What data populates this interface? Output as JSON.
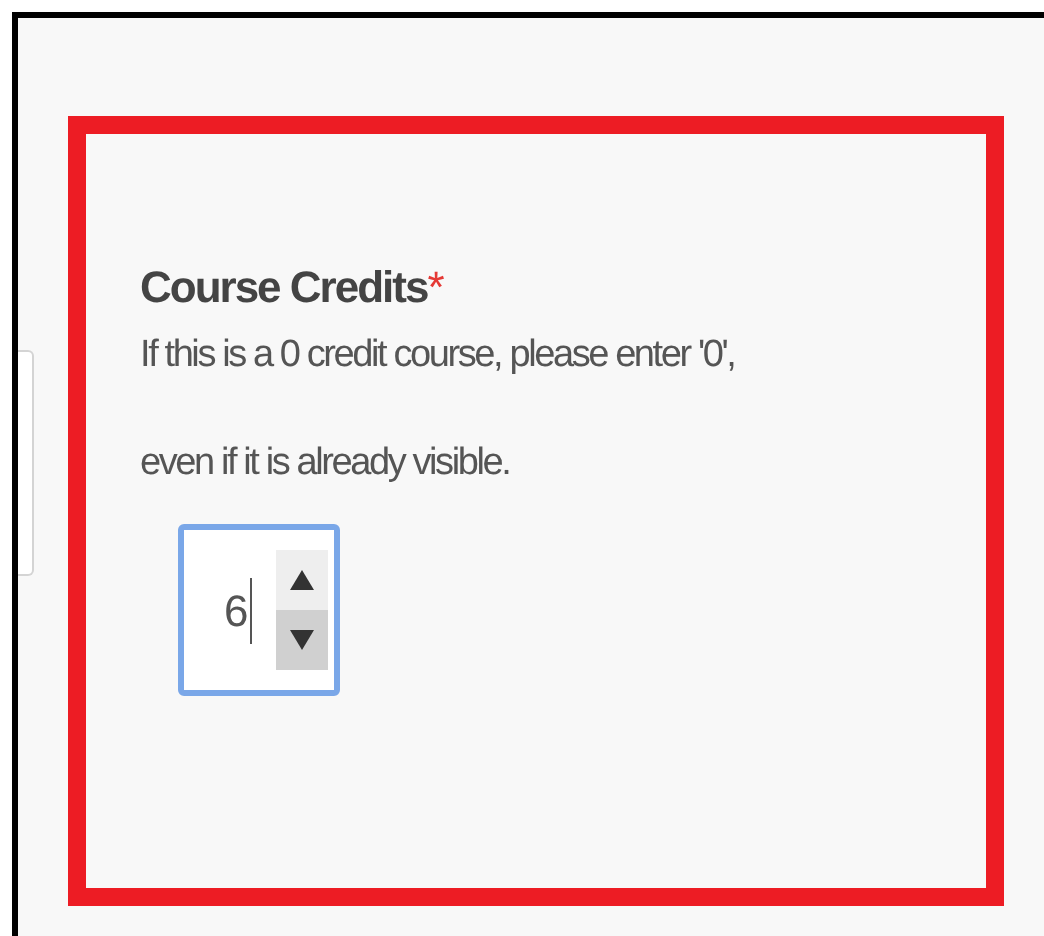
{
  "field": {
    "label": "Course Credits",
    "required_mark": "*",
    "help": "If this is a 0 credit course, please enter '0', even if it is already visible.",
    "value": "6",
    "highlighted": true,
    "focused": true
  }
}
